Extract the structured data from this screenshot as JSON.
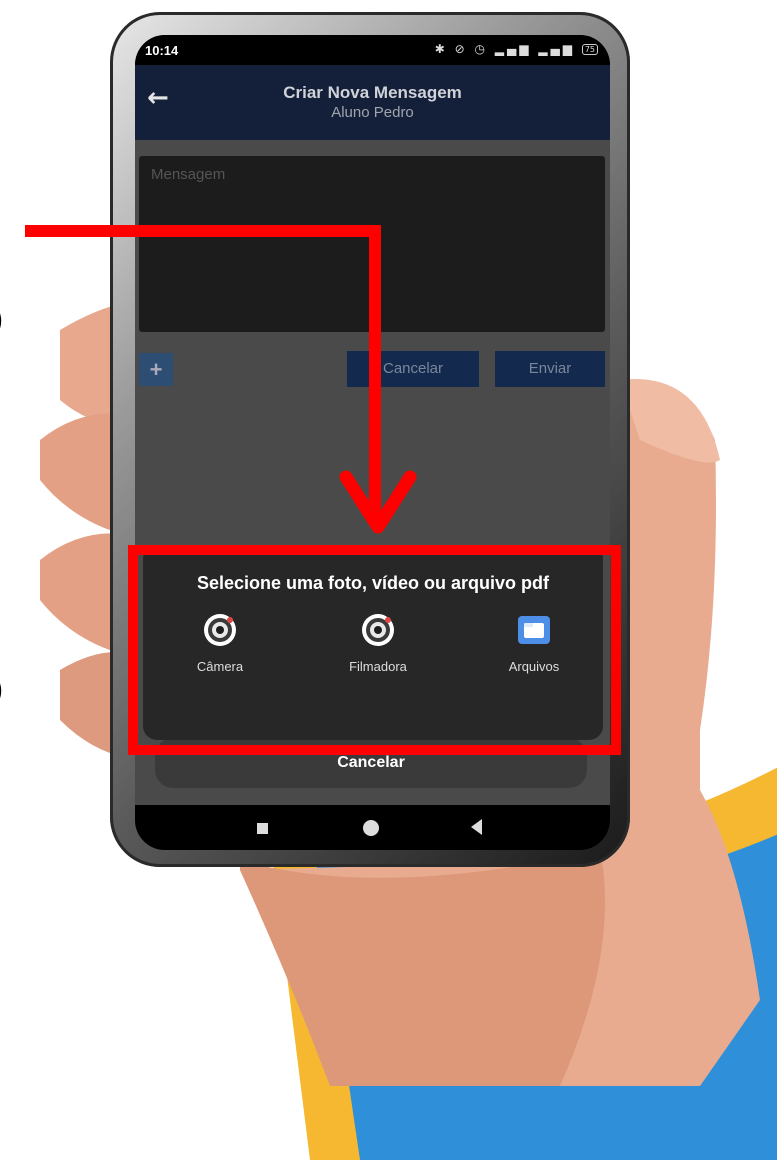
{
  "status_bar": {
    "time": "10:14",
    "battery": "75",
    "icons": [
      "bluetooth-icon",
      "mute-icon",
      "alarm-icon",
      "signal-icon",
      "signal-icon",
      "battery-icon"
    ]
  },
  "app_bar": {
    "back_icon": "arrow-left-icon",
    "title": "Criar Nova Mensagem",
    "subtitle": "Aluno Pedro",
    "color": "#14203a"
  },
  "compose": {
    "message_placeholder": "Mensagem",
    "add_label": "+",
    "cancel_label": "Cancelar",
    "send_label": "Enviar"
  },
  "sheet": {
    "title": "Selecione uma foto, vídeo ou arquivo pdf",
    "options": [
      {
        "label": "Câmera",
        "icon": "camera-icon"
      },
      {
        "label": "Filmadora",
        "icon": "video-camera-icon"
      },
      {
        "label": "Arquivos",
        "icon": "folder-icon"
      }
    ],
    "cancel_label": "Cancelar"
  },
  "annotation": {
    "highlight_color": "#ff0000"
  },
  "colors": {
    "folder": "#4d8fe6",
    "swoosh_yellow": "#f5b830",
    "swoosh_blue": "#2f8fd8"
  }
}
